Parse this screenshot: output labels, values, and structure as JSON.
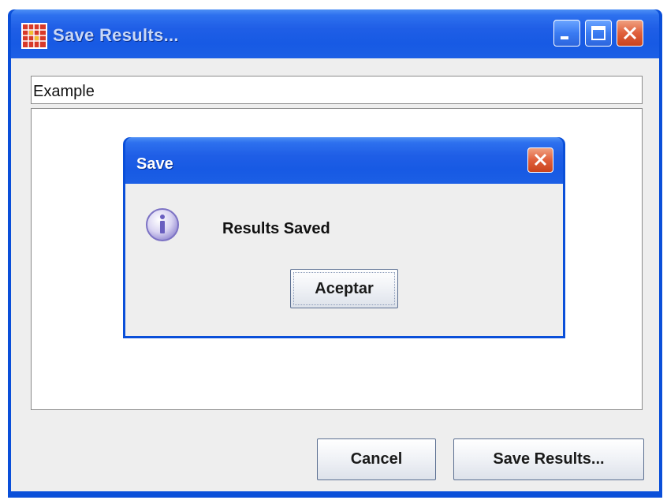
{
  "window": {
    "title": "Save Results..."
  },
  "main": {
    "example_field_value": "Example",
    "cancel_label": "Cancel",
    "save_label": "Save Results..."
  },
  "dialog": {
    "title": "Save",
    "message": "Results Saved",
    "ok_label": "Aceptar",
    "icon": "info-icon"
  },
  "colors": {
    "titlebar_blue": "#1f5ee6",
    "frame_blue": "#0a4fd9",
    "panel_gray": "#eeeeee",
    "close_red": "#e0603c"
  }
}
